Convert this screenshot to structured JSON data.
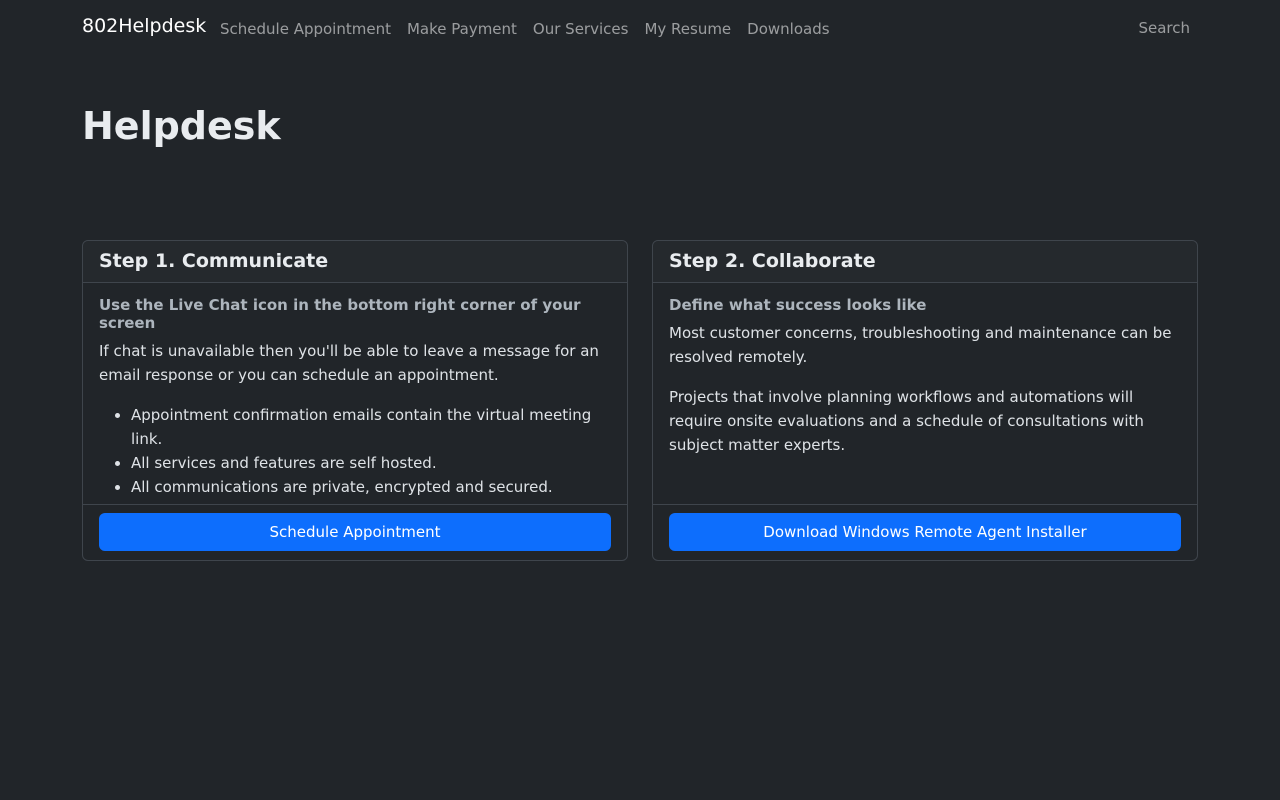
{
  "navbar": {
    "brand": "802Helpdesk",
    "links": [
      {
        "label": "Schedule Appointment"
      },
      {
        "label": "Make Payment"
      },
      {
        "label": "Our Services"
      },
      {
        "label": "My Resume"
      },
      {
        "label": "Downloads"
      }
    ],
    "search_label": "Search"
  },
  "page": {
    "title": "Helpdesk"
  },
  "cards": [
    {
      "header": "Step 1. Communicate",
      "subtitle": "Use the Live Chat icon in the bottom right corner of your screen",
      "text": "If chat is unavailable then you'll be able to leave a message for an email response or you can schedule an appointment.",
      "items": [
        "Appointment confirmation emails contain the virtual meeting link.",
        "All services and features are self hosted.",
        "All communications are private, encrypted and secured."
      ],
      "button_label": "Schedule Appointment"
    },
    {
      "header": "Step 2. Collaborate",
      "subtitle": "Define what success looks like",
      "paragraphs": [
        "Most customer concerns, troubleshooting and maintenance can be resolved remotely.",
        "Projects that involve planning workflows and automations will require onsite evaluations and a schedule of consultations with subject matter experts."
      ],
      "button_label": "Download Windows Remote Agent Installer"
    }
  ],
  "colors": {
    "background": "#212529",
    "primary": "#0d6efd",
    "border": "#3f454c"
  }
}
